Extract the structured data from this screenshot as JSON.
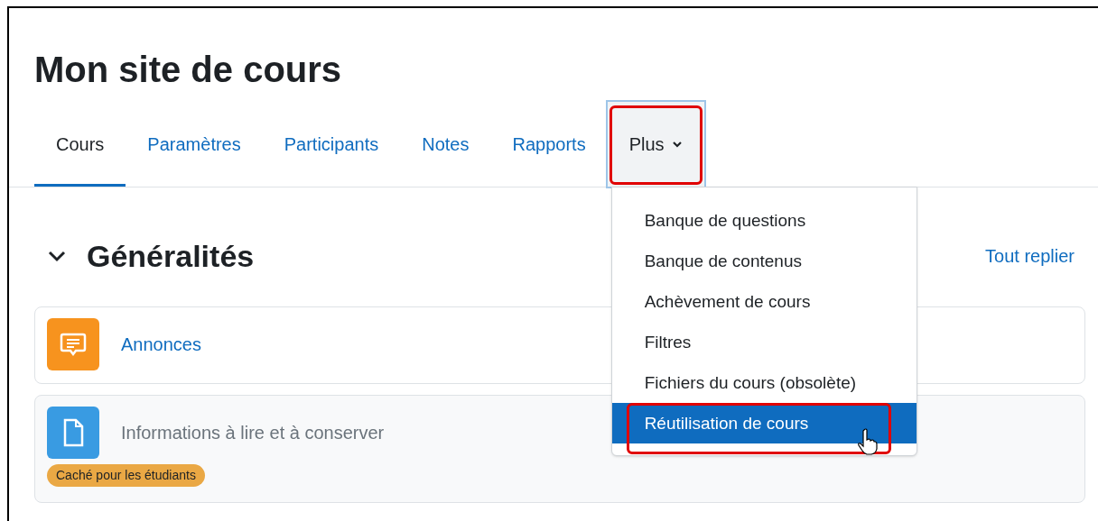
{
  "page_title": "Mon site de cours",
  "tabs": [
    {
      "label": "Cours",
      "selected": true,
      "highlighted": false
    },
    {
      "label": "Paramètres",
      "selected": false,
      "highlighted": false
    },
    {
      "label": "Participants",
      "selected": false,
      "highlighted": false
    },
    {
      "label": "Notes",
      "selected": false,
      "highlighted": false
    },
    {
      "label": "Rapports",
      "selected": false,
      "highlighted": false
    },
    {
      "label": "Plus",
      "selected": false,
      "highlighted": true,
      "kind": "dropdown",
      "expanded": true
    }
  ],
  "dropdown_menu": [
    {
      "label": "Banque de questions",
      "selected": false,
      "highlighted": false
    },
    {
      "label": "Banque de contenus",
      "selected": false,
      "highlighted": false
    },
    {
      "label": "Achèvement de cours",
      "selected": false,
      "highlighted": false
    },
    {
      "label": "Filtres",
      "selected": false,
      "highlighted": false
    },
    {
      "label": "Fichiers du cours (obsolète)",
      "selected": false,
      "highlighted": false
    },
    {
      "label": "Réutilisation de cours",
      "selected": true,
      "highlighted": true
    }
  ],
  "section": {
    "title": "Généralités",
    "expanded": true,
    "collapse_link": "Tout replier"
  },
  "activities": [
    {
      "kind": "forum",
      "name": "Annonces",
      "hidden": false
    },
    {
      "kind": "page",
      "name": "Informations à lire et à conserver",
      "hidden": true,
      "badge": "Caché pour les étudiants"
    }
  ]
}
